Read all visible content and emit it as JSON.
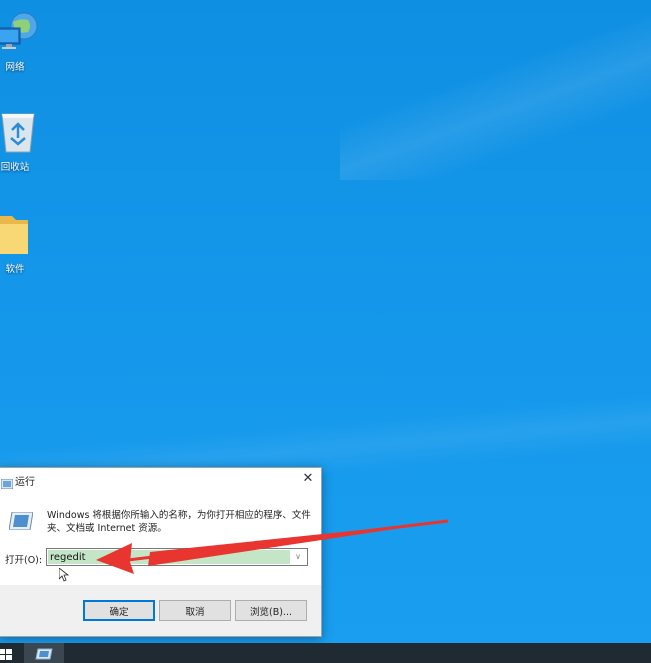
{
  "desktop": {
    "icons": [
      {
        "label": "网络",
        "icon": "network-icon"
      },
      {
        "label": "回收站",
        "icon": "recycle-bin-icon"
      },
      {
        "label": "软件",
        "icon": "folder-icon"
      }
    ]
  },
  "run_dialog": {
    "title": "运行",
    "close_glyph": "✕",
    "description": "Windows 将根据你所输入的名称，为你打开相应的程序、文件夹、文档或 Internet 资源。",
    "open_label": "打开(O):",
    "open_value": "regedit",
    "ok_label": "确定",
    "cancel_label": "取消",
    "browse_label": "浏览(B)..."
  },
  "colors": {
    "desktop_bg": "#1497ea",
    "selection": "#c5e6c6",
    "arrow": "#e8352f",
    "taskbar": "#1f2a33"
  }
}
